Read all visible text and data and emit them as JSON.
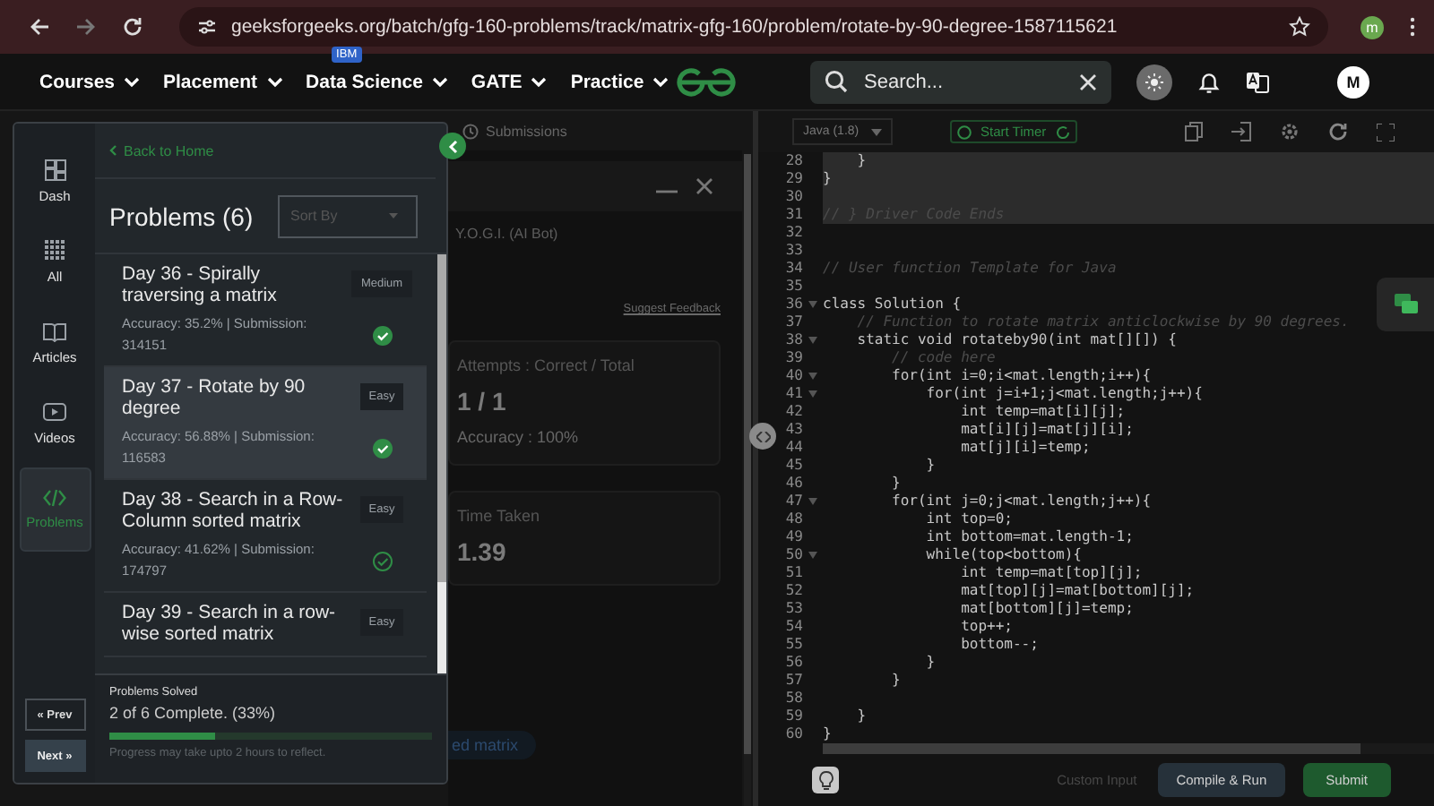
{
  "browser": {
    "url": "geeksforgeeks.org/batch/gfg-160-problems/track/matrix-gfg-160/problem/rotate-by-90-degree-1587115621",
    "profile_initial": "m"
  },
  "nav": {
    "items": [
      {
        "label": "Courses"
      },
      {
        "label": "Placement"
      },
      {
        "label": "Data Science",
        "badge": "IBM"
      },
      {
        "label": "GATE"
      },
      {
        "label": "Practice"
      }
    ],
    "search": {
      "placeholder": "Search..."
    },
    "avatar": "M"
  },
  "sidebar": {
    "items": [
      {
        "label": "Dash",
        "selected": false
      },
      {
        "label": "All",
        "selected": false
      },
      {
        "label": "Articles",
        "selected": false
      },
      {
        "label": "Videos",
        "selected": false
      },
      {
        "label": "Problems",
        "selected": true
      }
    ],
    "prev_button": "« Prev",
    "next_button": "Next »"
  },
  "problems_panel": {
    "back_link": "Back to Home",
    "title": "Problems (6)",
    "sort": {
      "placeholder": "Sort By"
    },
    "problems": [
      {
        "title": "Day 36 - Spirally traversing a matrix",
        "difficulty": "Medium",
        "stats": "Accuracy: 35.2% | Submission: 314151",
        "solved": true,
        "selected": false
      },
      {
        "title": "Day 37 - Rotate by 90 degree",
        "difficulty": "Easy",
        "stats": "Accuracy: 56.88% | Submission: 116583",
        "solved": true,
        "selected": true
      },
      {
        "title": "Day 38 - Search in a Row-Column sorted matrix",
        "difficulty": "Easy",
        "stats": "Accuracy: 41.62% | Submission: 174797",
        "solved": false,
        "selected": false
      },
      {
        "title": "Day 39 - Search in a row-wise sorted matrix",
        "difficulty": "Easy",
        "selected": false
      }
    ],
    "progress": {
      "heading": "Problems Solved",
      "summary": "2 of 6 Complete. (33%)",
      "level": 0.33,
      "note": "Progress may take upto 2 hours to reflect."
    }
  },
  "problem_pane": {
    "tab": "Submissions",
    "bot_title": "Y.O.G.I. (AI Bot)",
    "feedback_link": "Suggest Feedback",
    "stats": [
      {
        "label": "Attempts : Correct / Total",
        "value": "1 / 1",
        "detail": "Accuracy : 100%"
      },
      {
        "label": "Time Taken",
        "value": "1.39"
      }
    ],
    "tag_button": "ed matrix"
  },
  "editor": {
    "language": "Java (1.8)",
    "timer_button": "Start Timer",
    "lines": [
      {
        "number": "28",
        "kind": "code",
        "text": "    }",
        "fold": false,
        "highlighted": true
      },
      {
        "number": "29",
        "kind": "code",
        "text": "}",
        "fold": false,
        "highlighted": true
      },
      {
        "number": "30",
        "kind": "blank",
        "fold": false,
        "highlighted": true
      },
      {
        "number": "31",
        "kind": "comment",
        "text": "// } Driver Code Ends",
        "fold": false,
        "highlighted": true
      },
      {
        "number": "32",
        "kind": "blank",
        "fold": false,
        "highlighted": false
      },
      {
        "number": "33",
        "kind": "blank",
        "fold": false,
        "highlighted": false
      },
      {
        "number": "34",
        "kind": "comment",
        "text": "// User function Template for Java",
        "fold": false,
        "highlighted": false
      },
      {
        "number": "35",
        "kind": "blank",
        "fold": false,
        "highlighted": false
      },
      {
        "number": "36",
        "kind": "code",
        "text": "class Solution {",
        "fold": true,
        "highlighted": false
      },
      {
        "number": "37",
        "kind": "comment",
        "text": "    // Function to rotate matrix anticlockwise by 90 degrees.",
        "fold": false,
        "highlighted": false
      },
      {
        "number": "38",
        "kind": "code",
        "text": "    static void rotateby90(int mat[][]) {",
        "fold": true,
        "highlighted": false
      },
      {
        "number": "39",
        "kind": "comment",
        "text": "        // code here",
        "fold": false,
        "highlighted": false
      },
      {
        "number": "40",
        "kind": "code",
        "text": "        for(int i=0;i<mat.length;i++){",
        "fold": true,
        "highlighted": false
      },
      {
        "number": "41",
        "kind": "code",
        "text": "            for(int j=i+1;j<mat.length;j++){",
        "fold": true,
        "highlighted": false
      },
      {
        "number": "42",
        "kind": "code",
        "text": "                int temp=mat[i][j];",
        "fold": false,
        "highlighted": false
      },
      {
        "number": "43",
        "kind": "code",
        "text": "                mat[i][j]=mat[j][i];",
        "fold": false,
        "highlighted": false
      },
      {
        "number": "44",
        "kind": "code",
        "text": "                mat[j][i]=temp;",
        "fold": false,
        "highlighted": false
      },
      {
        "number": "45",
        "kind": "code",
        "text": "            }",
        "fold": false,
        "highlighted": false
      },
      {
        "number": "46",
        "kind": "code",
        "text": "        }",
        "fold": false,
        "highlighted": false
      },
      {
        "number": "47",
        "kind": "code",
        "text": "        for(int j=0;j<mat.length;j++){",
        "fold": true,
        "highlighted": false
      },
      {
        "number": "48",
        "kind": "code",
        "text": "            int top=0;",
        "fold": false,
        "highlighted": false
      },
      {
        "number": "49",
        "kind": "code",
        "text": "            int bottom=mat.length-1;",
        "fold": false,
        "highlighted": false
      },
      {
        "number": "50",
        "kind": "code",
        "text": "            while(top<bottom){",
        "fold": true,
        "highlighted": false
      },
      {
        "number": "51",
        "kind": "code",
        "text": "                int temp=mat[top][j];",
        "fold": false,
        "highlighted": false
      },
      {
        "number": "52",
        "kind": "code",
        "text": "                mat[top][j]=mat[bottom][j];",
        "fold": false,
        "highlighted": false
      },
      {
        "number": "53",
        "kind": "code",
        "text": "                mat[bottom][j]=temp;",
        "fold": false,
        "highlighted": false
      },
      {
        "number": "54",
        "kind": "code",
        "text": "                top++;",
        "fold": false,
        "highlighted": false
      },
      {
        "number": "55",
        "kind": "code",
        "text": "                bottom--;",
        "fold": false,
        "highlighted": false
      },
      {
        "number": "56",
        "kind": "code",
        "text": "            }",
        "fold": false,
        "highlighted": false
      },
      {
        "number": "57",
        "kind": "code",
        "text": "        }",
        "fold": false,
        "highlighted": false
      },
      {
        "number": "58",
        "kind": "blank",
        "fold": false,
        "highlighted": false
      },
      {
        "number": "59",
        "kind": "code",
        "text": "    }",
        "fold": false,
        "highlighted": false
      },
      {
        "number": "60",
        "kind": "code",
        "text": "}",
        "fold": false,
        "highlighted": false
      }
    ],
    "custom_input": "Custom Input",
    "compile_button": "Compile & Run",
    "submit_button": "Submit"
  }
}
